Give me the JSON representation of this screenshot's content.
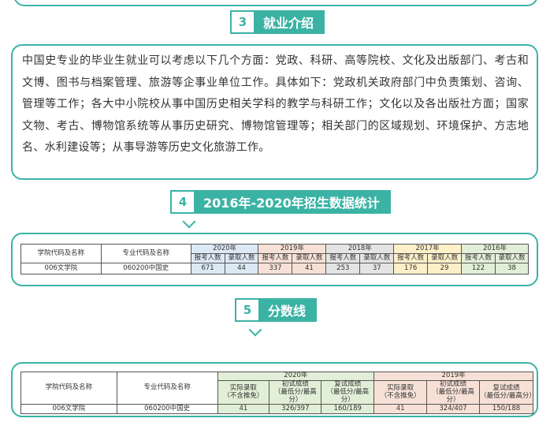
{
  "section3": {
    "number": "3",
    "title": "就业介绍",
    "paragraph": "中国史专业的毕业生就业可以考虑以下几个方面：党政、科研、高等院校、文化及出版部门、考古和文博、图书与档案管理、旅游等企事业单位工作。具体如下：党政机关政府部门中负责策划、咨询、管理等工作；各大中小院校从事中国历史相关学科的教学与科研工作；文化以及各出版社方面；国家文物、考古、博物馆系统等从事历史研究、博物馆管理等；相关部门的区域规划、环境保护、方志地名、水利建设等；从事导游等历史文化旅游工作。"
  },
  "section4": {
    "number": "4",
    "title": "2016年-2020年招生数据统计",
    "table": {
      "col1": "学院代码及名称",
      "col2": "专业代码及名称",
      "years": [
        "2020年",
        "2019年",
        "2018年",
        "2017年",
        "2016年"
      ],
      "sub1": "报考人数",
      "sub2": "录取人数",
      "row": {
        "college": "006文学院",
        "major": "060200中国史",
        "values": [
          "671",
          "44",
          "337",
          "41",
          "253",
          "37",
          "176",
          "29",
          "122",
          "38"
        ]
      }
    }
  },
  "section5": {
    "number": "5",
    "title": "分数线",
    "table": {
      "col1": "学院代码及名称",
      "col2": "专业代码及名称",
      "years": [
        "2020年",
        "2019年"
      ],
      "h_actual": "实际录取\n（不含推免）",
      "h_first": "初试成绩\n（最低分/最高分）",
      "h_second": "复试成绩\n（最低分/最高分）",
      "row": {
        "college": "006文学院",
        "major": "060200中国史",
        "values": [
          "41",
          "326/397",
          "160/189",
          "41",
          "324/407",
          "150/188"
        ]
      }
    }
  }
}
